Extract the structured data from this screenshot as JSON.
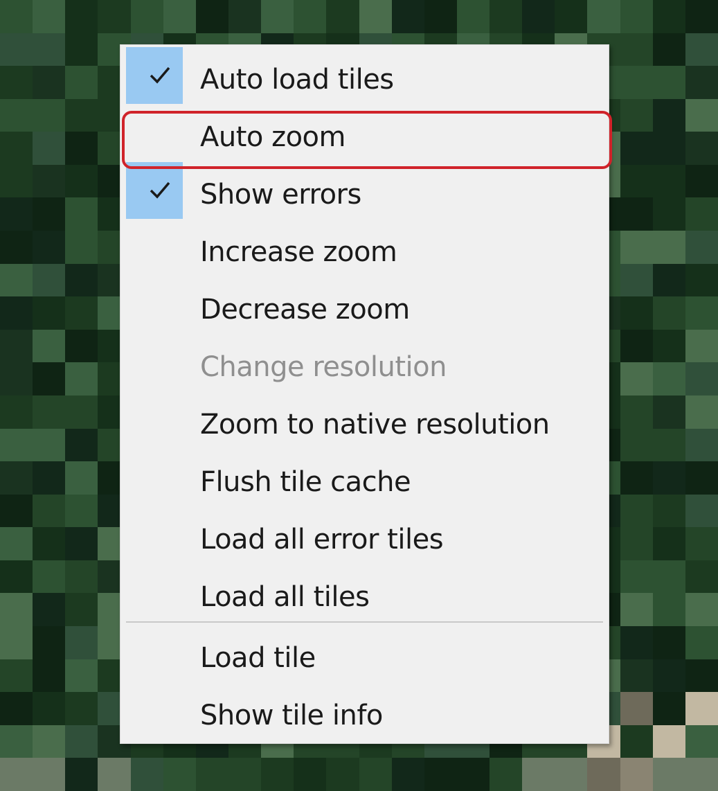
{
  "context_menu": {
    "items": [
      {
        "label": "Auto load tiles",
        "checked": true,
        "enabled": true
      },
      {
        "label": "Auto zoom",
        "checked": false,
        "enabled": true
      },
      {
        "label": "Show errors",
        "checked": true,
        "enabled": true
      },
      {
        "label": "Increase zoom",
        "checked": false,
        "enabled": true
      },
      {
        "label": "Decrease zoom",
        "checked": false,
        "enabled": true
      },
      {
        "label": "Change resolution",
        "checked": false,
        "enabled": false
      },
      {
        "label": "Zoom to native resolution",
        "checked": false,
        "enabled": true
      },
      {
        "label": "Flush tile cache",
        "checked": false,
        "enabled": true
      },
      {
        "label": "Load all error tiles",
        "checked": false,
        "enabled": true
      },
      {
        "label": "Load all tiles",
        "checked": false,
        "enabled": true
      },
      {
        "label": "Load tile",
        "checked": false,
        "enabled": true
      },
      {
        "label": "Show tile info",
        "checked": false,
        "enabled": true
      }
    ],
    "highlighted_item": "Auto zoom"
  },
  "colors": {
    "menu_background": "#f0f0f0",
    "check_background": "#99c9f2",
    "highlight_border": "#d0232a",
    "disabled_text": "#8f8f8f"
  }
}
